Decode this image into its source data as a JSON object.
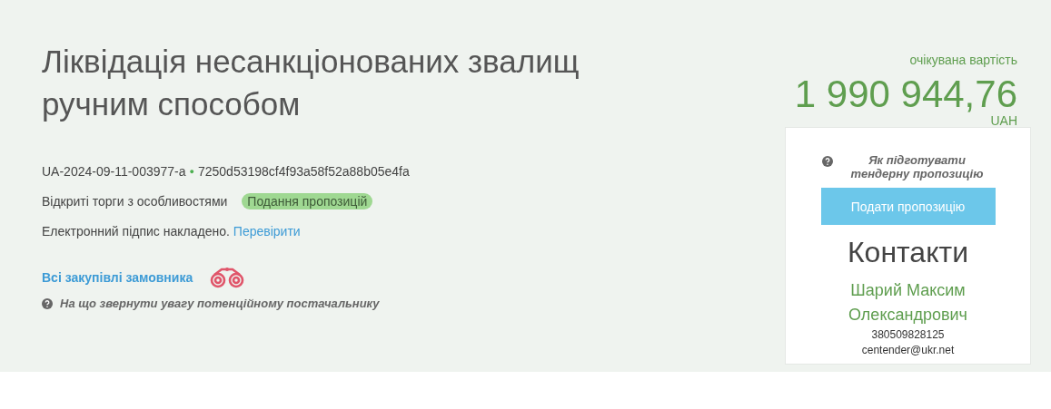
{
  "tender": {
    "title": "Ліквідація несанкціонованих звалищ ручним способом",
    "id": "UA-2024-09-11-003977-a",
    "separator": "●",
    "hash": "7250d53198cf4f93a58f52a88b05e4fa",
    "procedure": "Відкриті торги з особливостями",
    "status": "Подання пропозицій",
    "signature": "Електронний підпис накладено.",
    "signature_link": "Перевірити",
    "buyer_link": "Всі закупівлі замовника",
    "hint": "На що звернути увагу потенційному постачальнику"
  },
  "price": {
    "label": "очікувана вартість",
    "amount": "1 990 944,76",
    "currency": "UAH"
  },
  "sidebar": {
    "hint": "Як підготувати тендерну пропозицію",
    "button": "Подати пропозицію",
    "contacts_title": "Контакти",
    "contact_name": "Шарий Максим Олександрович",
    "phone": "380509828125",
    "email": "centender@ukr.net"
  }
}
